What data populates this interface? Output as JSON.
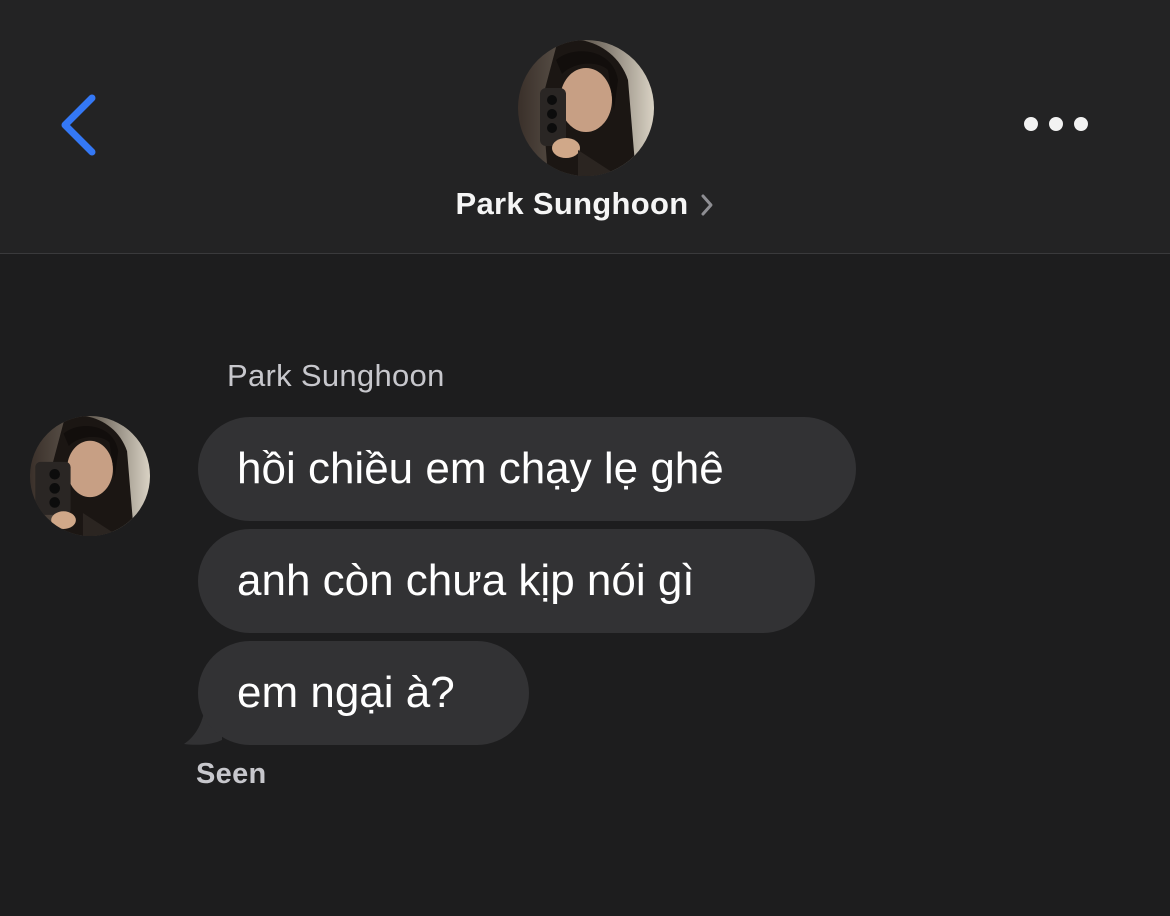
{
  "header": {
    "contact_name": "Park Sunghoon",
    "back_icon": "chevron-left-icon",
    "more_icon": "ellipsis-icon",
    "name_chevron_icon": "chevron-right-icon",
    "accent_color": "#3478f6"
  },
  "thread": {
    "sender_name": "Park Sunghoon",
    "messages": [
      {
        "text": "hồi chiều em chạy lẹ ghê"
      },
      {
        "text": "anh còn chưa kịp nói gì"
      },
      {
        "text": "em ngại à?"
      }
    ],
    "status": "Seen"
  },
  "colors": {
    "background": "#1d1d1e",
    "header_background": "#232324",
    "bubble": "#323234",
    "text_primary": "#ffffff",
    "text_secondary": "#c7c7cc"
  }
}
